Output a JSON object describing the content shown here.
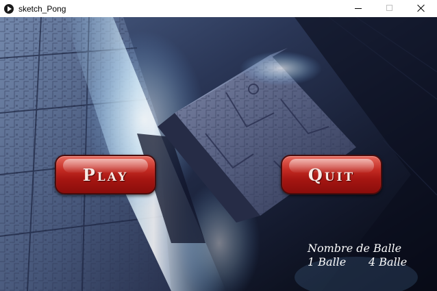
{
  "window": {
    "title": "sketch_Pong"
  },
  "menu": {
    "play_label": "Play",
    "quit_label": "Quit"
  },
  "balls": {
    "title": "Nombre de Balle",
    "option_1": "1 Balle",
    "option_4": "4 Balle"
  },
  "colors": {
    "button_red": "#b01c16",
    "background_dark": "#0b0f1e",
    "light_beam": "#dff4ff"
  },
  "icons": {
    "app": "play-circle-icon",
    "minimize": "minimize-icon",
    "maximize": "maximize-icon",
    "close": "close-icon"
  }
}
